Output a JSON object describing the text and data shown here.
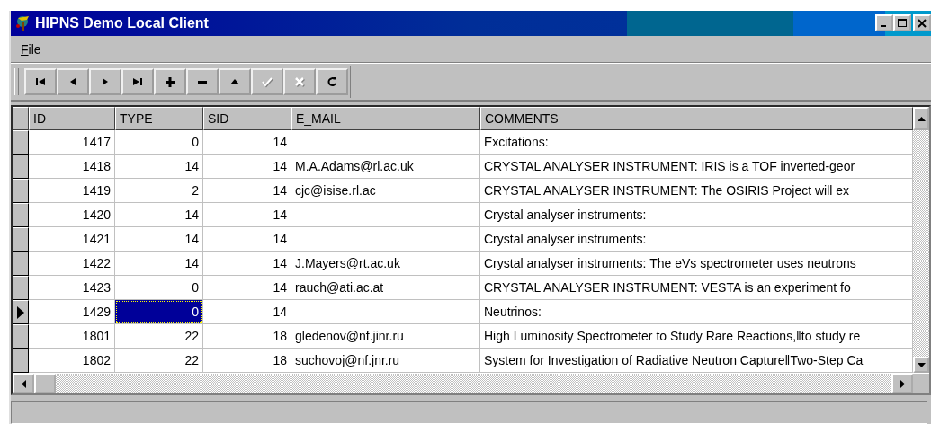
{
  "window": {
    "title": "HIPNS Demo Local Client"
  },
  "menu": [
    {
      "label": "File"
    }
  ],
  "toolbar": [
    {
      "kind": "first",
      "disabled": false
    },
    {
      "kind": "prior",
      "disabled": false
    },
    {
      "kind": "next",
      "disabled": false
    },
    {
      "kind": "last",
      "disabled": false
    },
    {
      "kind": "insert",
      "disabled": false
    },
    {
      "kind": "delete",
      "disabled": false
    },
    {
      "kind": "edit",
      "disabled": false
    },
    {
      "kind": "post",
      "disabled": true
    },
    {
      "kind": "cancel",
      "disabled": true
    },
    {
      "kind": "refresh",
      "disabled": false
    }
  ],
  "table": {
    "columns": [
      {
        "label": "ID"
      },
      {
        "label": "TYPE"
      },
      {
        "label": "SID"
      },
      {
        "label": "E_MAIL"
      },
      {
        "label": "COMMENTS"
      }
    ],
    "rows": [
      {
        "current": false,
        "cells": [
          {
            "text": "1417",
            "selected": false
          },
          {
            "text": "0",
            "selected": false
          },
          {
            "text": "14",
            "selected": false
          },
          {
            "selected": false
          },
          {
            "text": "Excitations:",
            "selected": false
          }
        ]
      },
      {
        "current": false,
        "cells": [
          {
            "text": "1418",
            "selected": false
          },
          {
            "text": "14",
            "selected": false
          },
          {
            "text": "14",
            "selected": false
          },
          {
            "text": "M.A.Adams@rl.ac.uk",
            "selected": false
          },
          {
            "text": "CRYSTAL ANALYSER INSTRUMENT: IRIS is a TOF inverted-geor",
            "selected": false
          }
        ]
      },
      {
        "current": false,
        "cells": [
          {
            "text": "1419",
            "selected": false
          },
          {
            "text": "2",
            "selected": false
          },
          {
            "text": "14",
            "selected": false
          },
          {
            "text": "cjc@isise.rl.ac",
            "selected": false
          },
          {
            "text": "CRYSTAL ANALYSER INSTRUMENT:  The OSIRIS Project will ex",
            "selected": false
          }
        ]
      },
      {
        "current": false,
        "cells": [
          {
            "text": "1420",
            "selected": false
          },
          {
            "text": "14",
            "selected": false
          },
          {
            "text": "14",
            "selected": false
          },
          {
            "selected": false
          },
          {
            "text": "Crystal analyser instruments:",
            "selected": false
          }
        ]
      },
      {
        "current": false,
        "cells": [
          {
            "text": "1421",
            "selected": false
          },
          {
            "text": "14",
            "selected": false
          },
          {
            "text": "14",
            "selected": false
          },
          {
            "selected": false
          },
          {
            "text": "Crystal analyser instruments:",
            "selected": false
          }
        ]
      },
      {
        "current": false,
        "cells": [
          {
            "text": "1422",
            "selected": false
          },
          {
            "text": "14",
            "selected": false
          },
          {
            "text": "14",
            "selected": false
          },
          {
            "text": "J.Mayers@rt.ac.uk",
            "selected": false
          },
          {
            "text": "Crystal analyser instruments:  The eVs spectrometer uses neutrons",
            "selected": false
          }
        ]
      },
      {
        "current": false,
        "cells": [
          {
            "text": "1423",
            "selected": false
          },
          {
            "text": "0",
            "selected": false
          },
          {
            "text": "14",
            "selected": false
          },
          {
            "text": "rauch@ati.ac.at",
            "selected": false
          },
          {
            "text": "CRYSTAL ANALYSER  INSTRUMENT: VESTA is an experiment fo",
            "selected": false
          }
        ]
      },
      {
        "current": true,
        "cells": [
          {
            "text": "1429",
            "selected": false
          },
          {
            "text": "0",
            "selected": true
          },
          {
            "text": "14",
            "selected": false
          },
          {
            "selected": false
          },
          {
            "text": "Neutrinos:",
            "selected": false
          }
        ]
      },
      {
        "current": false,
        "cells": [
          {
            "text": "1801",
            "selected": false
          },
          {
            "text": "22",
            "selected": false
          },
          {
            "text": "18",
            "selected": false
          },
          {
            "text": "gledenov@nf.jinr.ru",
            "selected": false
          },
          {
            "text": "High Luminosity Spectrometer to Study Rare Reactions,‖to study re",
            "selected": false
          }
        ]
      },
      {
        "current": false,
        "cells": [
          {
            "text": "1802",
            "selected": false
          },
          {
            "text": "22",
            "selected": false
          },
          {
            "text": "18",
            "selected": false
          },
          {
            "text": "suchovoj@nf.jnr.ru",
            "selected": false
          },
          {
            "text": "System for Investigation of Radiative Neutron Capture‖Two-Step Ca",
            "selected": false
          }
        ]
      }
    ]
  }
}
